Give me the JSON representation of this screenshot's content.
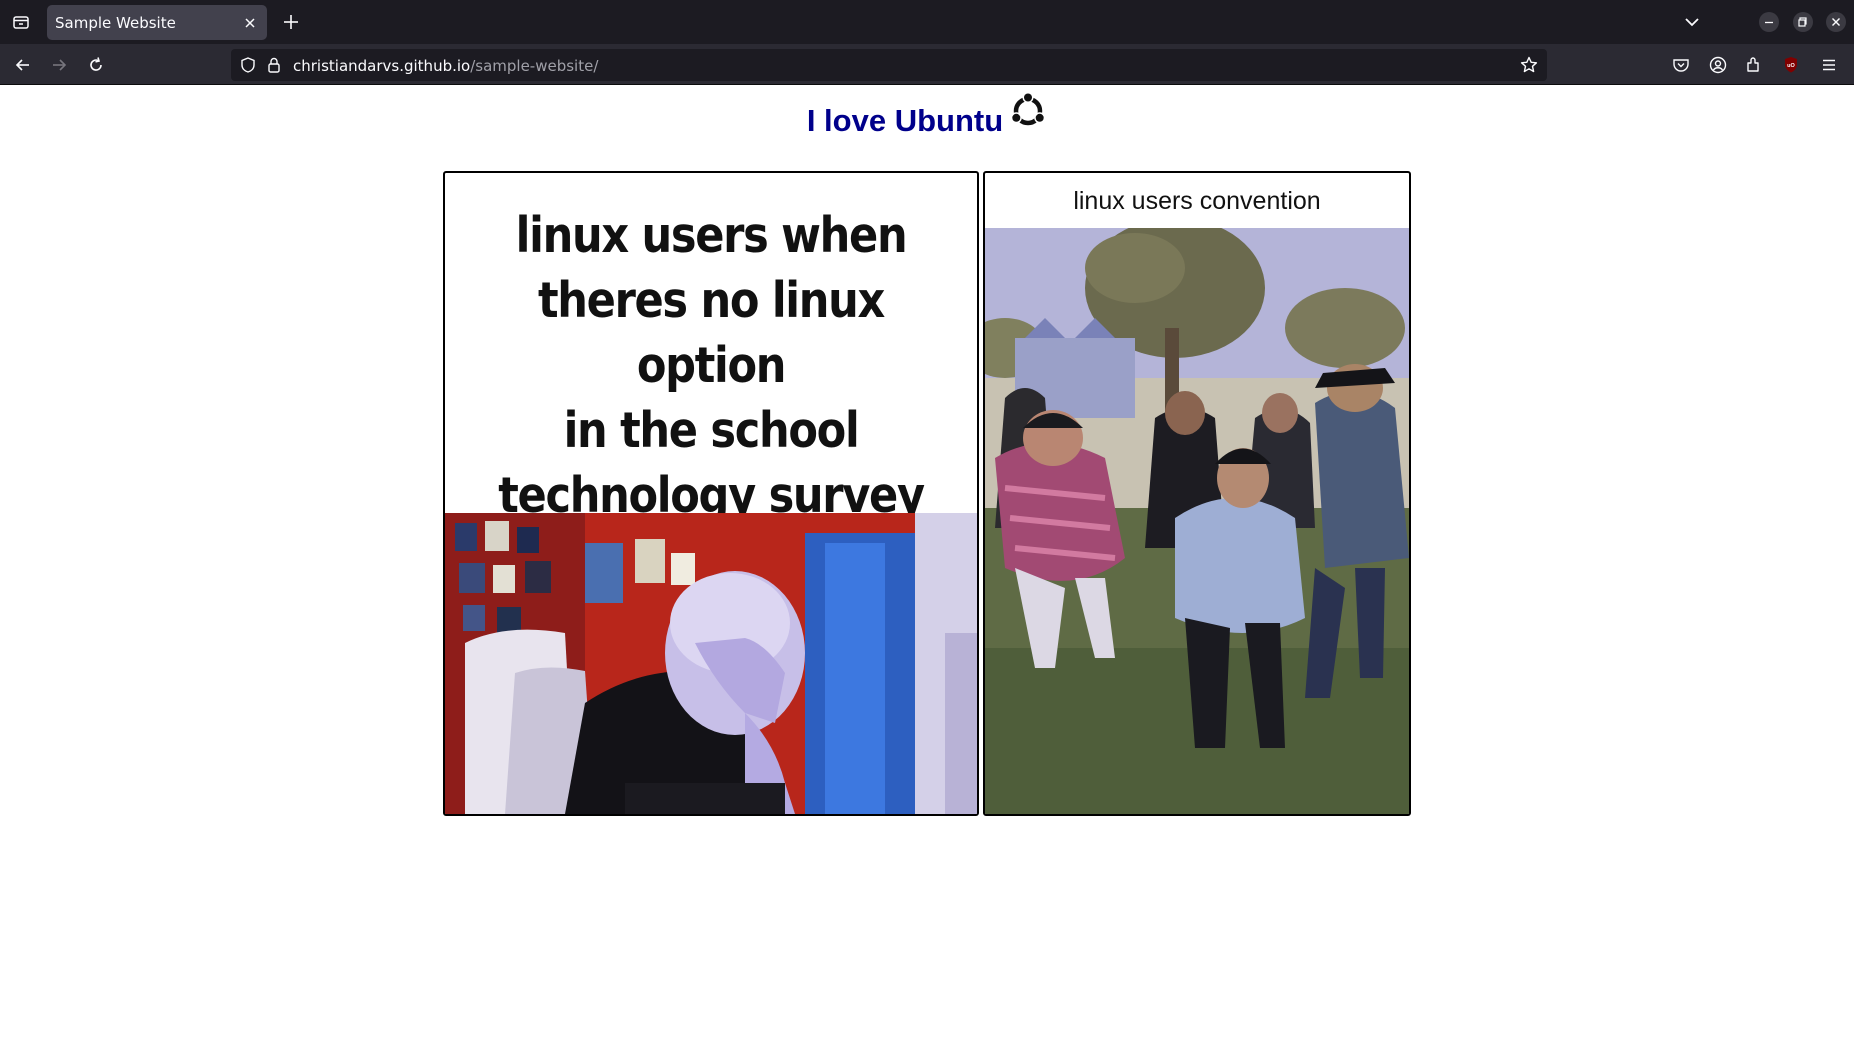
{
  "browser": {
    "tab_title": "Sample Website",
    "url_host": "christiandarvs.github.io",
    "url_path": "/sample-website/",
    "icons": [
      "tab-list-icon",
      "close-icon",
      "plus-icon",
      "chevron-down-icon",
      "minimize-icon",
      "restore-icon",
      "close-window-icon",
      "back-icon",
      "forward-icon",
      "reload-icon",
      "shield-icon",
      "lock-icon",
      "star-icon",
      "pocket-icon",
      "account-icon",
      "extensions-icon",
      "ublock-icon",
      "menu-icon"
    ]
  },
  "page": {
    "heading": "I love Ubuntu",
    "left_meme": {
      "caption_lines": [
        "linux users when",
        "theres no linux option",
        "in the school",
        "technology survey"
      ]
    },
    "right_meme": {
      "title": "linux users convention"
    }
  },
  "colors": {
    "heading": "#00008b",
    "chrome_dark": "#1c1b22",
    "chrome_mid": "#2b2a33",
    "tab_active": "#42414d"
  }
}
